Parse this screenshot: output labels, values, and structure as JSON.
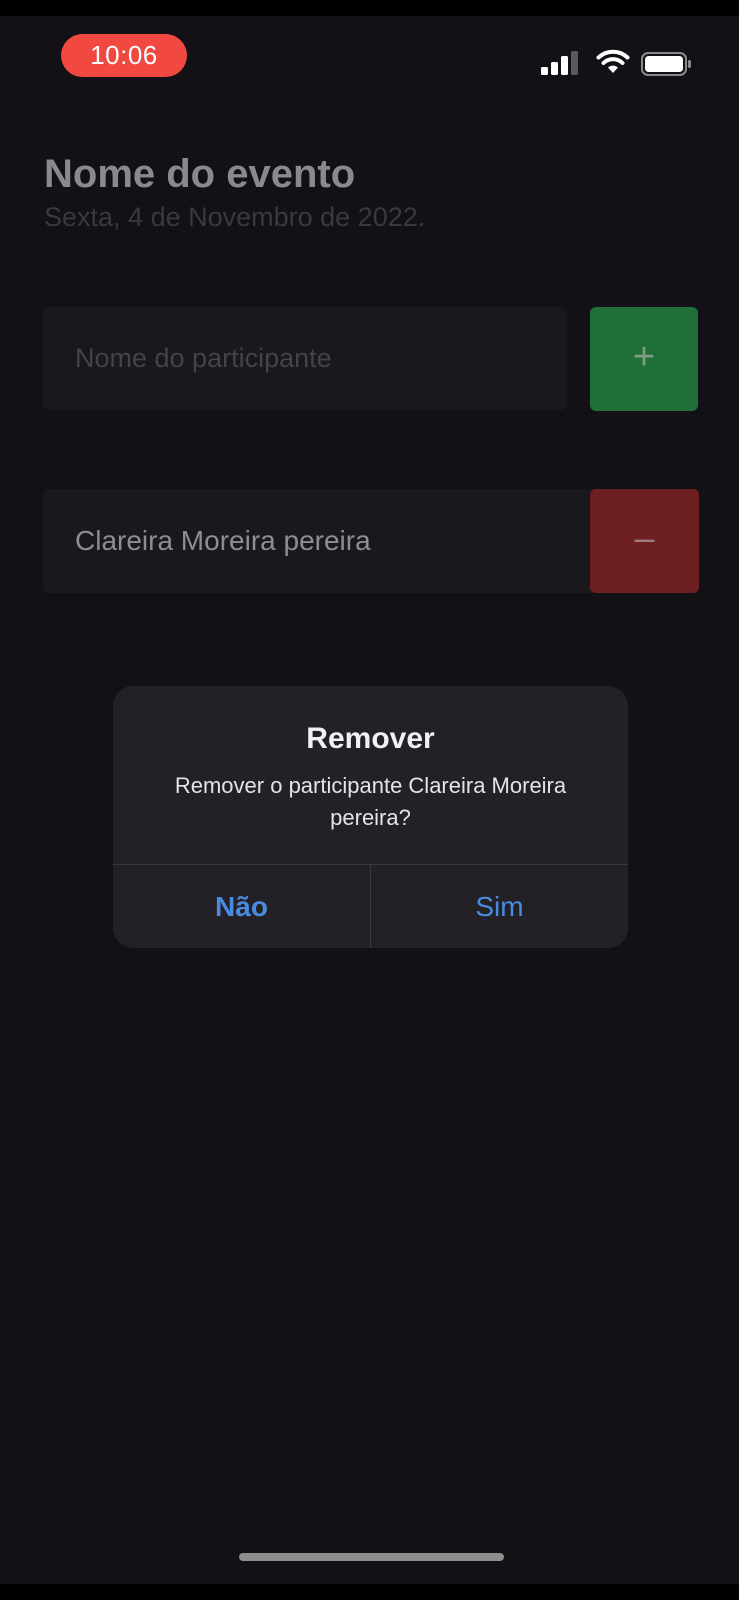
{
  "status_bar": {
    "time": "10:06",
    "icons": [
      "signal-icon",
      "wifi-icon",
      "battery-icon"
    ]
  },
  "event": {
    "title": "Nome do evento",
    "date": "Sexta, 4 de Novembro de 2022."
  },
  "participant_input": {
    "placeholder": "Nome do participante",
    "value": ""
  },
  "add_button": {
    "label": "+",
    "color": "#1e6f38"
  },
  "participants": [
    {
      "name": "Clareira Moreira pereira",
      "remove_label": "–"
    }
  ],
  "remove_button_color": "#6e1f22",
  "alert": {
    "title": "Remover",
    "message": "Remover o participante Clareira Moreira pereira?",
    "buttons": {
      "no": "Não",
      "yes": "Sim"
    },
    "button_color": "#4a8be0"
  },
  "colors": {
    "background": "#131016",
    "time_pill": "#f1493f"
  }
}
